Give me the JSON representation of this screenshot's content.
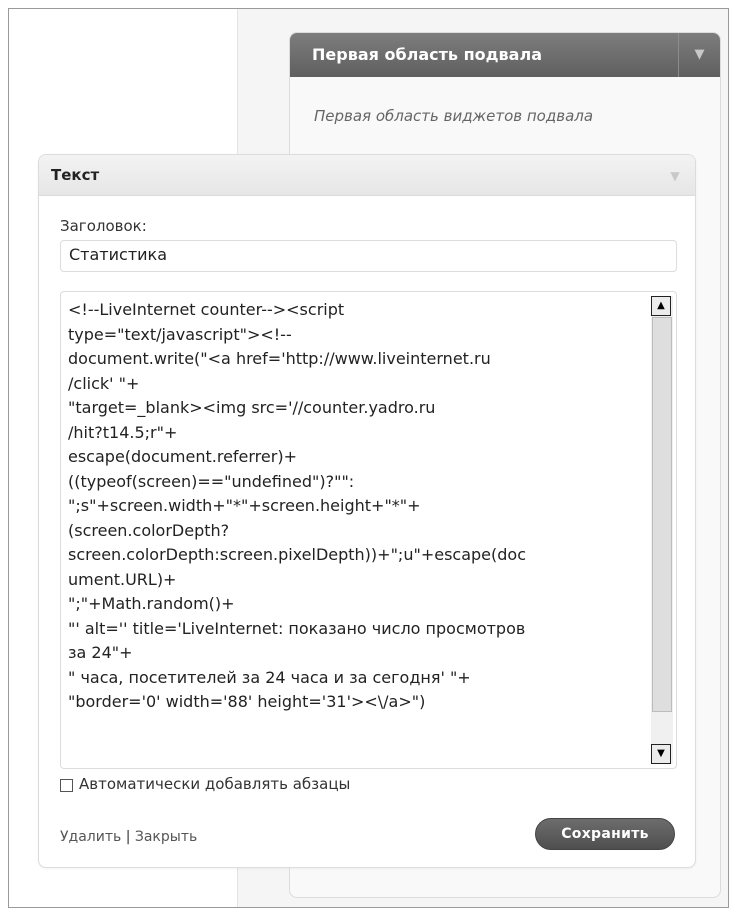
{
  "sidebar": {
    "title": "Первая область подвала",
    "toggle_icon": "▼",
    "description": "Первая область виджетов подвала"
  },
  "widget": {
    "title": "Текст",
    "toggle_icon": "▼",
    "title_label": "Заголовок:",
    "title_value": "Статистика",
    "content": "<!--LiveInternet counter--><script\ntype=\"text/javascript\"><!--\ndocument.write(\"<a href='http://www.liveinternet.ru\n/click' \"+\n\"target=_blank><img src='//counter.yadro.ru\n/hit?t14.5;r\"+\nescape(document.referrer)+\n((typeof(screen)==\"undefined\")?\"\":\n\";s\"+screen.width+\"*\"+screen.height+\"*\"+\n(screen.colorDepth?\nscreen.colorDepth:screen.pixelDepth))+\";u\"+escape(doc\nument.URL)+\n\";\"+Math.random()+\n\"' alt='' title='LiveInternet: показано число просмотров\nза 24\"+\n\" часа, посетителей за 24 часа и за сегодня' \"+\n\"border='0' width='88' height='31'><\\/a>\")",
    "autop_label": "Автоматически добавлять абзацы",
    "autop_checked": false,
    "delete_label": "Удалить",
    "separator": "|",
    "close_label": "Закрыть",
    "save_label": "Сохранить"
  },
  "scrollbar": {
    "up_icon": "▲",
    "down_icon": "▼"
  }
}
